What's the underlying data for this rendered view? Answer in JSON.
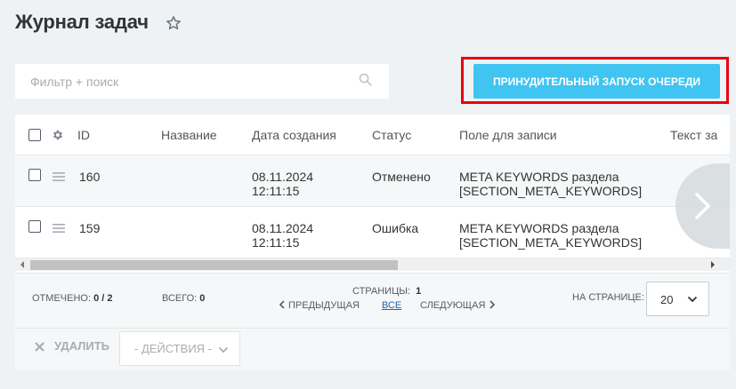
{
  "page": {
    "title": "Журнал задач"
  },
  "filter": {
    "placeholder": "Фильтр + поиск"
  },
  "toolbar": {
    "run_queue_label": "Принудительный запуск очереди"
  },
  "grid": {
    "columns": [
      "ID",
      "Название",
      "Дата создания",
      "Статус",
      "Поле для записи",
      "Текст за"
    ],
    "rows": [
      {
        "id": "160",
        "name": "",
        "date": "08.11.2024",
        "time": "12:11:15",
        "status": "Отменено",
        "field_line1": "META KEYWORDS раздела",
        "field_line2": "[SECTION_META_KEYWORDS]"
      },
      {
        "id": "159",
        "name": "",
        "date": "08.11.2024",
        "time": "12:11:15",
        "status": "Ошибка",
        "field_line1": "META KEYWORDS раздела",
        "field_line2": "[SECTION_META_KEYWORDS]"
      }
    ]
  },
  "footer": {
    "selected_label": "Отмечено:",
    "selected_value": "0 / 2",
    "total_label": "Всего:",
    "total_value": "0",
    "pages_label": "Страницы:",
    "pages_value": "1",
    "prev_label": "Предыдущая",
    "all_label": "Все",
    "next_label": "Следующая",
    "per_page_label": "На странице:",
    "per_page_value": "20"
  },
  "actions": {
    "delete_label": "Удалить",
    "actions_placeholder": "- Действия -"
  },
  "colors": {
    "accent": "#40c4f1",
    "highlight": "#e60012",
    "background": "#eef2f4"
  }
}
